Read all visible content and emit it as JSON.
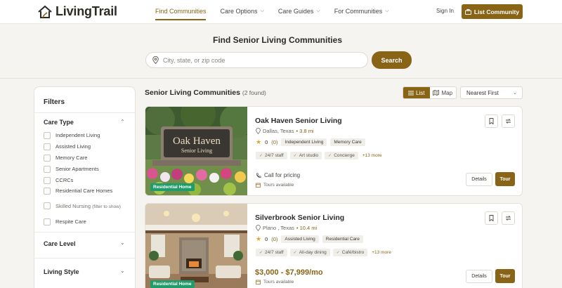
{
  "header": {
    "brand": "LivingTrail",
    "nav": [
      {
        "label": "Find Communities",
        "active": true,
        "dropdown": false
      },
      {
        "label": "Care Options",
        "active": false,
        "dropdown": true
      },
      {
        "label": "Care Guides",
        "active": false,
        "dropdown": true
      },
      {
        "label": "For Communities",
        "active": false,
        "dropdown": true
      }
    ],
    "signin": "Sign In",
    "list_button": "List Community"
  },
  "hero": {
    "title": "Find Senior Living Communities",
    "search_placeholder": "City, state, or zip code",
    "search_button": "Search"
  },
  "filters": {
    "title": "Filters",
    "care_type": {
      "title": "Care Type",
      "options": [
        "Independent Living",
        "Assisted Living",
        "Memory Care",
        "Senior Apartments",
        "CCRCs",
        "Residential Care Homes"
      ],
      "skilled_nursing": "Skilled Nursing",
      "skilled_nursing_note": "(filter to show)",
      "respite": "Respite Care"
    },
    "care_level": "Care Level",
    "living_style": "Living Style"
  },
  "results": {
    "title": "Senior Living Communities",
    "count": "(2 found)",
    "view_list": "List",
    "view_map": "Map",
    "sort": "Nearest First"
  },
  "cards": [
    {
      "name": "Oak Haven Senior Living",
      "city": "Dallas, Texas",
      "distance": "• 3.8 mi",
      "rating": "0",
      "reviews": "(0)",
      "care_tags": [
        "Independent Living",
        "Memory Care"
      ],
      "amenities": [
        "24/7 staff",
        "Art studio",
        "Concierge"
      ],
      "more": "+13 more",
      "price": "Call for pricing",
      "tours": "Tours available",
      "badge": "Residential Home",
      "details": "Details",
      "tour": "Tour",
      "sign_line1": "Oak Haven",
      "sign_line2": "Senior Living"
    },
    {
      "name": "Silverbrook Senior Living",
      "city": "Plano , Texas",
      "distance": "• 10.4 mi",
      "rating": "0",
      "reviews": "(0)",
      "care_tags": [
        "Assisted Living",
        "Residential Care"
      ],
      "amenities": [
        "24/7 staff",
        "All-day dining",
        "Café/bistro"
      ],
      "more": "+13 more",
      "price": "$3,000 - $7,999/mo",
      "tours": "Tours available",
      "badge": "Residential Home",
      "details": "Details",
      "tour": "Tour"
    }
  ]
}
